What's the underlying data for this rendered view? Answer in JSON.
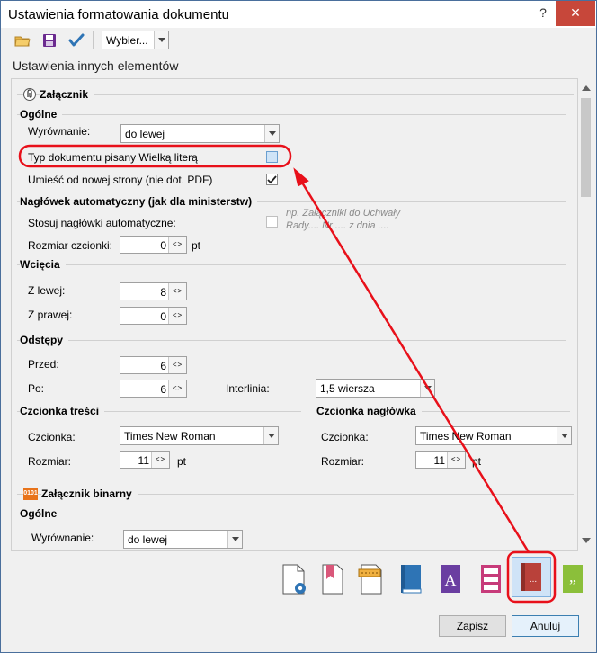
{
  "window": {
    "title": "Ustawienia formatowania dokumentu",
    "help_glyph": "?",
    "close_glyph": "✕"
  },
  "toolbar": {
    "combo_value": "Wybier..."
  },
  "subtitle": "Ustawienia innych elementów",
  "zalacznik": {
    "title": "Załącznik",
    "ogolne": {
      "title": "Ogólne",
      "alignment_label": "Wyrównanie:",
      "alignment_value": "do lewej",
      "uppercase_label": "Typ dokumentu pisany Wielką literą",
      "uppercase_checked": false,
      "newpage_label": "Umieść od nowej strony (nie dot. PDF)",
      "newpage_checked": true
    },
    "naglowek": {
      "title": "Nagłówek automatyczny (jak dla ministerstw)",
      "apply_label": "Stosuj nagłówki automatyczne:",
      "apply_checked": false,
      "hint": "np. Załączniki do Uchwały Rady.... Nr .... z dnia ....",
      "fontsize_label": "Rozmiar czcionki:",
      "fontsize_value": "0",
      "fontsize_unit": "pt"
    },
    "wciecia": {
      "title": "Wcięcia",
      "left_label": "Z lewej:",
      "left_value": "8",
      "right_label": "Z prawej:",
      "right_value": "0"
    },
    "odstepy": {
      "title": "Odstępy",
      "before_label": "Przed:",
      "before_value": "6",
      "after_label": "Po:",
      "after_value": "6",
      "interline_label": "Interlinia:",
      "interline_value": "1,5 wiersza"
    },
    "czcionka_tresci": {
      "title": "Czcionka treści",
      "font_label": "Czcionka:",
      "font_value": "Times New Roman",
      "size_label": "Rozmiar:",
      "size_value": "11",
      "size_unit": "pt"
    },
    "czcionka_naglowka": {
      "title": "Czcionka nagłówka",
      "font_label": "Czcionka:",
      "font_value": "Times New Roman",
      "size_label": "Rozmiar:",
      "size_value": "11",
      "size_unit": "pt"
    }
  },
  "zalacznik_binarny": {
    "title": "Załącznik binarny",
    "icon_text": "0101",
    "ogolne": {
      "title": "Ogólne",
      "alignment_label": "Wyrównanie:",
      "alignment_value": "do lewej"
    }
  },
  "spin_arrows": "<>",
  "bottom_icons": [
    "document-settings-icon",
    "document-bookmark-icon",
    "document-header-icon",
    "book-blue-icon",
    "font-letter-icon",
    "list-columns-icon",
    "attachment-book-icon",
    "quote-icon"
  ],
  "letter_icon_text": "A",
  "attachment_icon_text": "...",
  "quote_icon_text": "„",
  "buttons": {
    "save": "Zapisz",
    "cancel": "Anuluj"
  },
  "colors": {
    "annotation": "#e8101a",
    "accent_blue": "#2e74b5"
  }
}
